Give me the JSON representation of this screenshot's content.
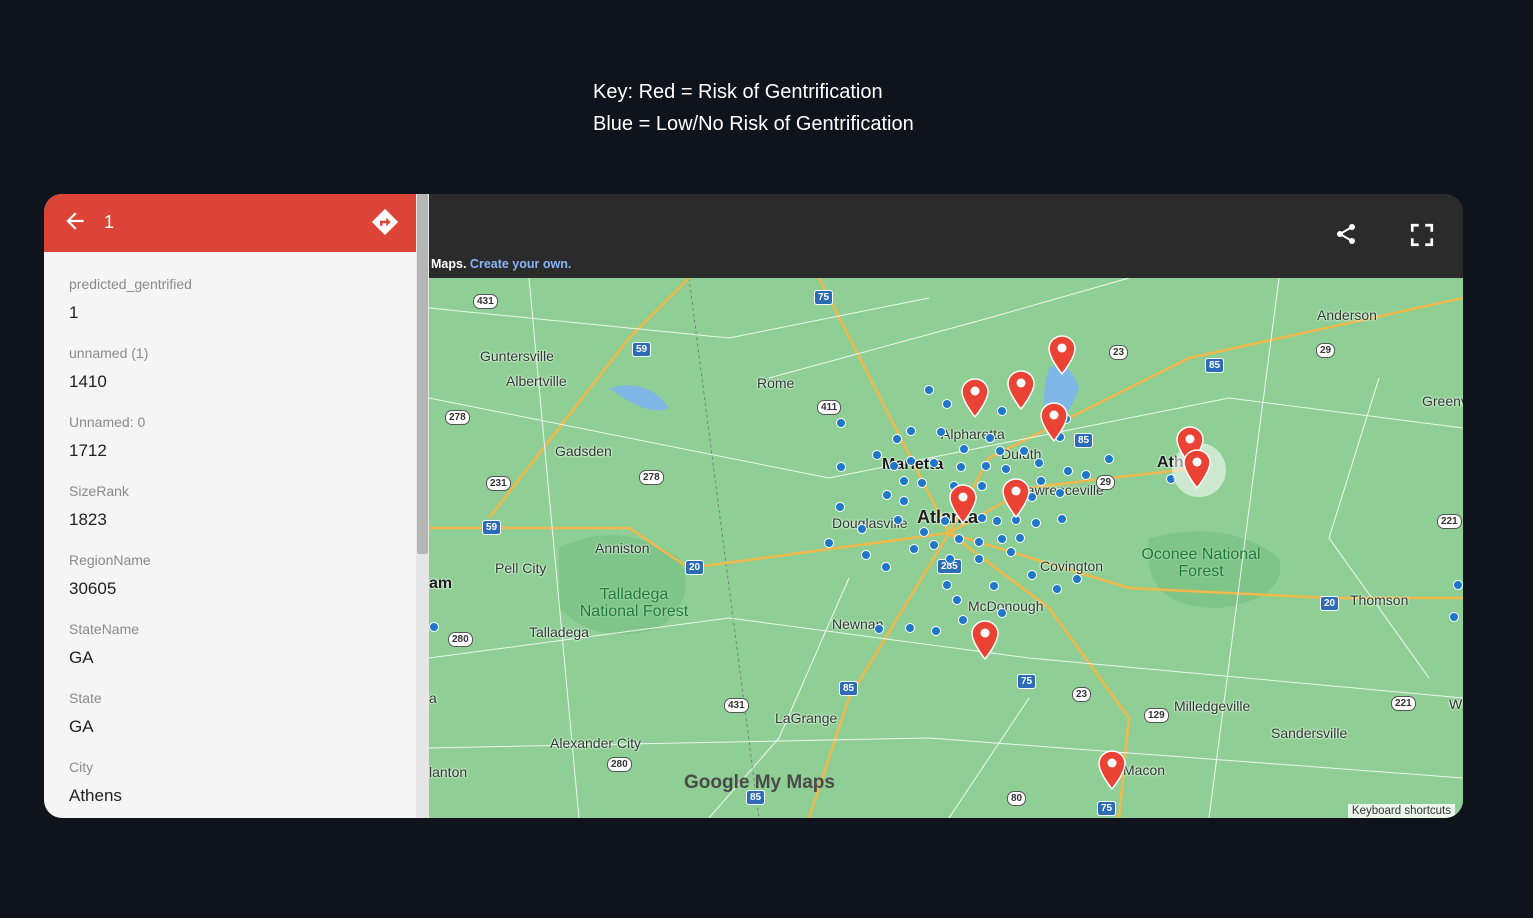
{
  "key": {
    "line1": "Key: Red = Risk of Gentrification",
    "line2": "Blue = Low/No Risk of Gentrification"
  },
  "panel": {
    "title": "1",
    "fields": [
      {
        "label": "predicted_gentrified",
        "value": "1"
      },
      {
        "label": "unnamed (1)",
        "value": "1410"
      },
      {
        "label": "Unnamed: 0",
        "value": "1712"
      },
      {
        "label": "SizeRank",
        "value": "1823"
      },
      {
        "label": "RegionName",
        "value": "30605"
      },
      {
        "label": "StateName",
        "value": "GA"
      },
      {
        "label": "State",
        "value": "GA"
      },
      {
        "label": "City",
        "value": "Athens"
      }
    ]
  },
  "map_header": {
    "attribution_prefix": "Maps.",
    "attribution_link": "Create your own."
  },
  "map": {
    "colors": {
      "red_pin": "#ea4335",
      "blue_dot": "#1e77c8",
      "land": "#8fcf95",
      "header": "#db4437"
    },
    "places": [
      "Guntersville",
      "Albertville",
      "Rome",
      "Gadsden",
      "Anniston",
      "Pell City",
      "Talladega",
      "Alexander City",
      "LaGrange",
      "Newnan",
      "Douglasville",
      "Marietta",
      "Atlanta",
      "Alpharetta",
      "Duluth",
      "Lawrenceville",
      "Athens",
      "Covington",
      "McDonough",
      "Milledgeville",
      "Sandersville",
      "Thomson",
      "Anderson",
      "Greenv",
      "Macon",
      "am",
      "lanton",
      "a",
      "W"
    ],
    "parks": [
      "Talladega National Forest",
      "Oconee National Forest"
    ],
    "logo": "Google My Maps",
    "keyboard_shortcuts": "Keyboard shortcuts"
  }
}
